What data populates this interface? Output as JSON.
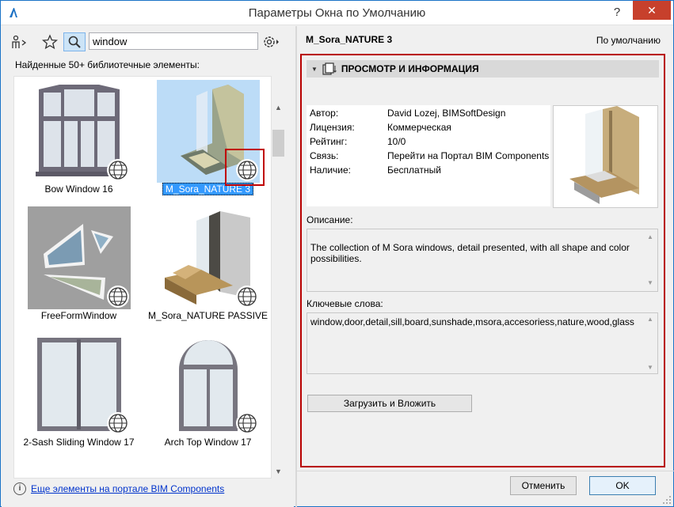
{
  "window": {
    "title": "Параметры Окна по Умолчанию",
    "help": "?",
    "close": "✕"
  },
  "search": {
    "value": "window"
  },
  "library": {
    "found_label": "Найденные 50+ библиотечные элементы:",
    "items": [
      {
        "label": "Bow Window 16",
        "selected": false
      },
      {
        "label": "M_Sora_NATURE 3",
        "selected": true
      },
      {
        "label": "FreeFormWindow",
        "selected": false
      },
      {
        "label": "M_Sora_NATURE PASSIVE",
        "selected": false
      },
      {
        "label": "2-Sash Sliding Window 17",
        "selected": false
      },
      {
        "label": "Arch Top Window 17",
        "selected": false
      }
    ],
    "portal_link": "Еще элементы на портале BIM Components"
  },
  "details": {
    "name": "M_Sora_NATURE 3",
    "default_label": "По умолчанию",
    "section_title": "ПРОСМОТР И ИНФОРМАЦИЯ",
    "info": [
      {
        "key": "Автор:",
        "value": "David Lozej, BIMSoftDesign"
      },
      {
        "key": "Лицензия:",
        "value": "Коммерческая"
      },
      {
        "key": "Рейтинг:",
        "value": "10/0"
      },
      {
        "key": "Связь:",
        "value": "Перейти на Портал BIM Components"
      },
      {
        "key": "Наличие:",
        "value": "Бесплатный"
      }
    ],
    "description_label": "Описание:",
    "description": "The collection of M Sora windows, detail presented, with all shape and color possibilities.",
    "keywords_label": "Ключевые слова:",
    "keywords": "window,door,detail,sill,board,sunshade,msora,accesoriess,nature,wood,glass",
    "load_button": "Загрузить и Вложить"
  },
  "footer": {
    "cancel": "Отменить",
    "ok": "OK"
  },
  "colors": {
    "highlight": "#c00000",
    "selection": "#3399ff",
    "link": "#0033cc",
    "close": "#c7402c"
  }
}
